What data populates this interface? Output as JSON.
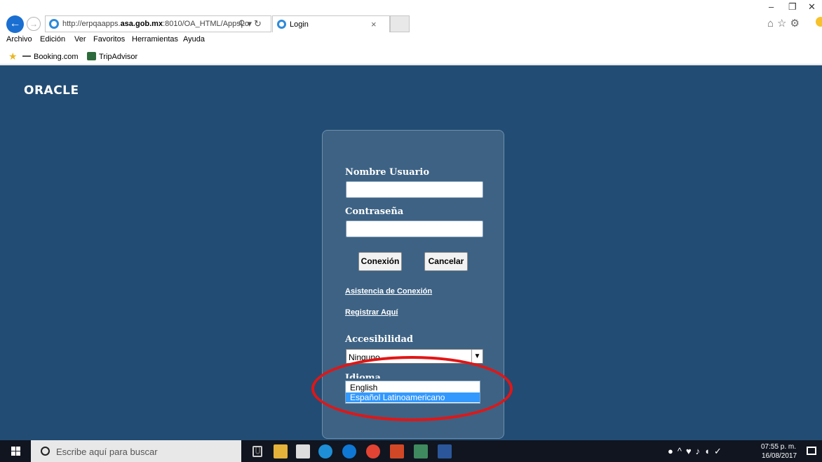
{
  "browser": {
    "url_prefix": "http://erpqaapps.",
    "url_domain": "asa.gob.mx",
    "url_suffix": ":8010/OA_HTML/AppsLo",
    "tab_title": "Login",
    "tab_close": "×"
  },
  "menu": [
    "Archivo",
    "Edición",
    "Ver",
    "Favoritos",
    "Herramientas",
    "Ayuda"
  ],
  "favorites": [
    "Booking.com",
    "TripAdvisor"
  ],
  "page": {
    "logo": "ORACLE",
    "username_label": "Nombre Usuario",
    "username_value": "",
    "password_label": "Contraseña",
    "password_value": "",
    "login_button": "Conexión",
    "cancel_button": "Cancelar",
    "help_link": "Asistencia de Conexión",
    "register_link": "Registrar Aquí",
    "accessibility_label": "Accesibilidad",
    "accessibility_value": "Ninguno",
    "language_label": "Idioma",
    "language_options": [
      "English",
      "Español Latinoamericano"
    ],
    "language_selected": "Español Latinoamericano"
  },
  "annotation": {
    "color": "#e31515",
    "shape": "ellipse"
  },
  "taskbar": {
    "search_placeholder": "Escribe aquí para buscar",
    "time": "07:55 p. m.",
    "date": "16/08/2017"
  },
  "colors": {
    "page_background": "#224c73",
    "login_box": "#3d6284",
    "dropdown_selected": "#3399ff"
  }
}
